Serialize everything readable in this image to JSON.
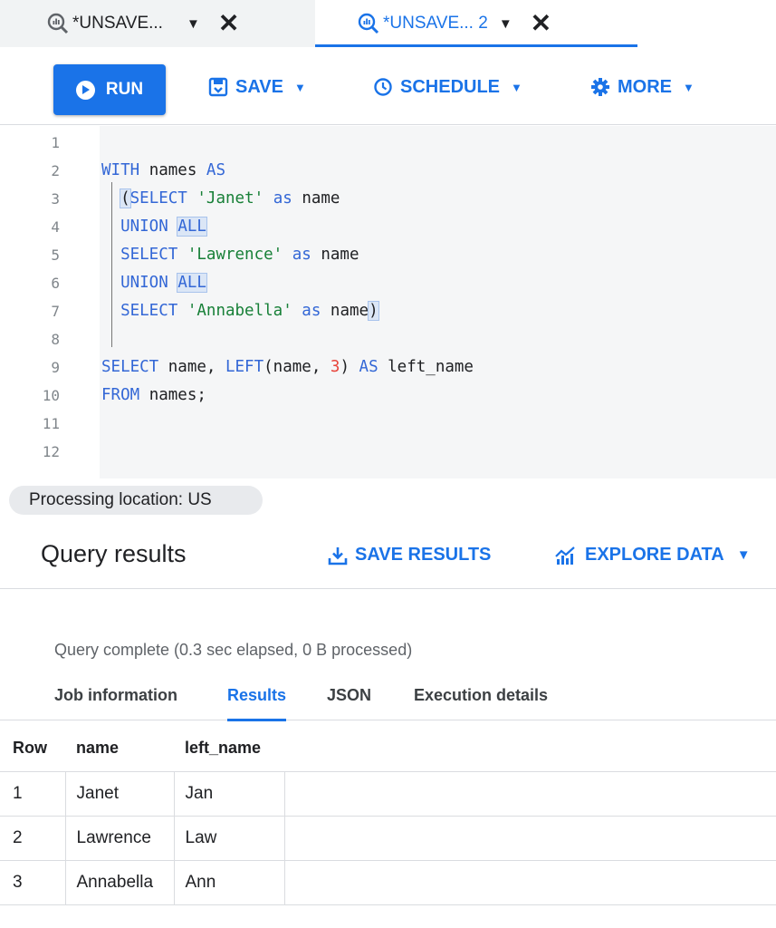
{
  "tabs": [
    {
      "label": "*UNSAVE...",
      "active": false
    },
    {
      "label": "*UNSAVE... 2",
      "active": true
    }
  ],
  "toolbar": {
    "run_label": "RUN",
    "save_label": "SAVE",
    "schedule_label": "SCHEDULE",
    "more_label": "MORE"
  },
  "editor": {
    "line_numbers": [
      "1",
      "2",
      "3",
      "4",
      "5",
      "6",
      "7",
      "8",
      "9",
      "10",
      "11",
      "12"
    ]
  },
  "processing_location": "Processing location: US",
  "results": {
    "title": "Query results",
    "save_results_label": "SAVE RESULTS",
    "explore_data_label": "EXPLORE DATA",
    "status": "Query complete (0.3 sec elapsed, 0 B processed)",
    "subtabs": [
      "Job information",
      "Results",
      "JSON",
      "Execution details"
    ],
    "active_subtab": "Results",
    "columns": [
      "Row",
      "name",
      "left_name"
    ],
    "rows": [
      [
        "1",
        "Janet",
        "Jan"
      ],
      [
        "2",
        "Lawrence",
        "Law"
      ],
      [
        "3",
        "Annabella",
        "Ann"
      ]
    ]
  },
  "colors": {
    "accent": "#1a73e8",
    "keyword": "#3367d6",
    "string": "#188038",
    "number": "#e8453c"
  }
}
